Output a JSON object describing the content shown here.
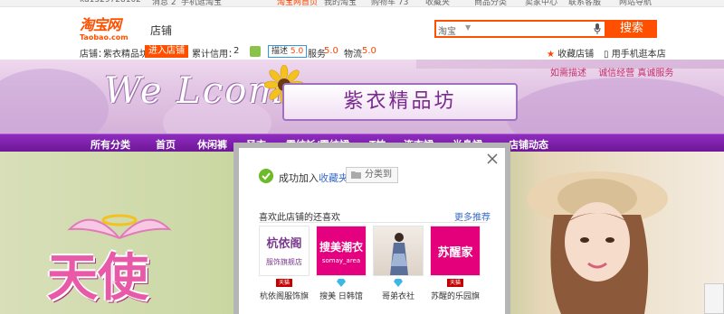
{
  "topbar": {
    "account": "ku1329728102",
    "messages": "消息 2",
    "mobile_taobao": "手机逛淘宝",
    "my_taobao": "我的淘宝",
    "cart": "购物车 73",
    "favorites": "收藏夹",
    "categories": "商品分类",
    "seller_center": "卖家中心",
    "contact": "联系客服",
    "site_nav": "网站导航",
    "taobao_home": "淘宝网首页"
  },
  "header": {
    "logo_cn": "淘宝网",
    "logo_en": "Taobao.com",
    "shop_tag": "店铺",
    "search_scope": "淘宝",
    "search_value": "",
    "search_button": "搜索",
    "shop_label": "店铺：",
    "shop_name": "紫衣精品坊",
    "enter_shop": "进入店铺",
    "credit_label": "累计信用：",
    "credit_value": "2",
    "desc_label": "描述",
    "desc_score": "5.0",
    "service_label": "服务",
    "service_score": "5.0",
    "logistics_label": "物流",
    "logistics_score": "5.0",
    "collect_shop": "收藏店铺",
    "mobile_visit": "用手机逛本店"
  },
  "banner": {
    "welcome": "We Lcome",
    "shop_title": "紫衣精品坊",
    "link1": "如需描述",
    "link2": "诚信经营 真诚服务"
  },
  "nav": {
    "items": [
      "所有分类",
      "首页",
      "休闲裤",
      "风衣",
      "雪纺衫/雪纺裙",
      "T恤",
      "连衣裙",
      "半身裙",
      "店铺动态"
    ]
  },
  "lower": {
    "headline": "天使"
  },
  "popup": {
    "success_prefix": "成功加入",
    "success_link": "收藏夹",
    "classify_button": "分类到",
    "rec_title": "喜欢此店铺的还喜欢",
    "more_link": "更多推荐",
    "shops": [
      {
        "img_line1": "杭依阁",
        "img_line2": "服饰旗舰店",
        "name": "杭依阁服饰旗",
        "badge": "tmall"
      },
      {
        "img_line1": "搜美潮衣",
        "img_line2": "somay_area",
        "name": "搜美 日韩馆",
        "badge": "diamond"
      },
      {
        "img_line1": "",
        "img_line2": "",
        "name": "哥弟衣社",
        "badge": "diamond"
      },
      {
        "img_line1": "苏醒家",
        "img_line2": "",
        "name": "苏醒的乐园旗",
        "badge": "tmall"
      }
    ],
    "tmall_label": "天猫"
  },
  "colors": {
    "brand": "#ff5000",
    "nav_purple": "#7a1fa8",
    "link_blue": "#3a6cc7",
    "success_green": "#6dbb29"
  }
}
